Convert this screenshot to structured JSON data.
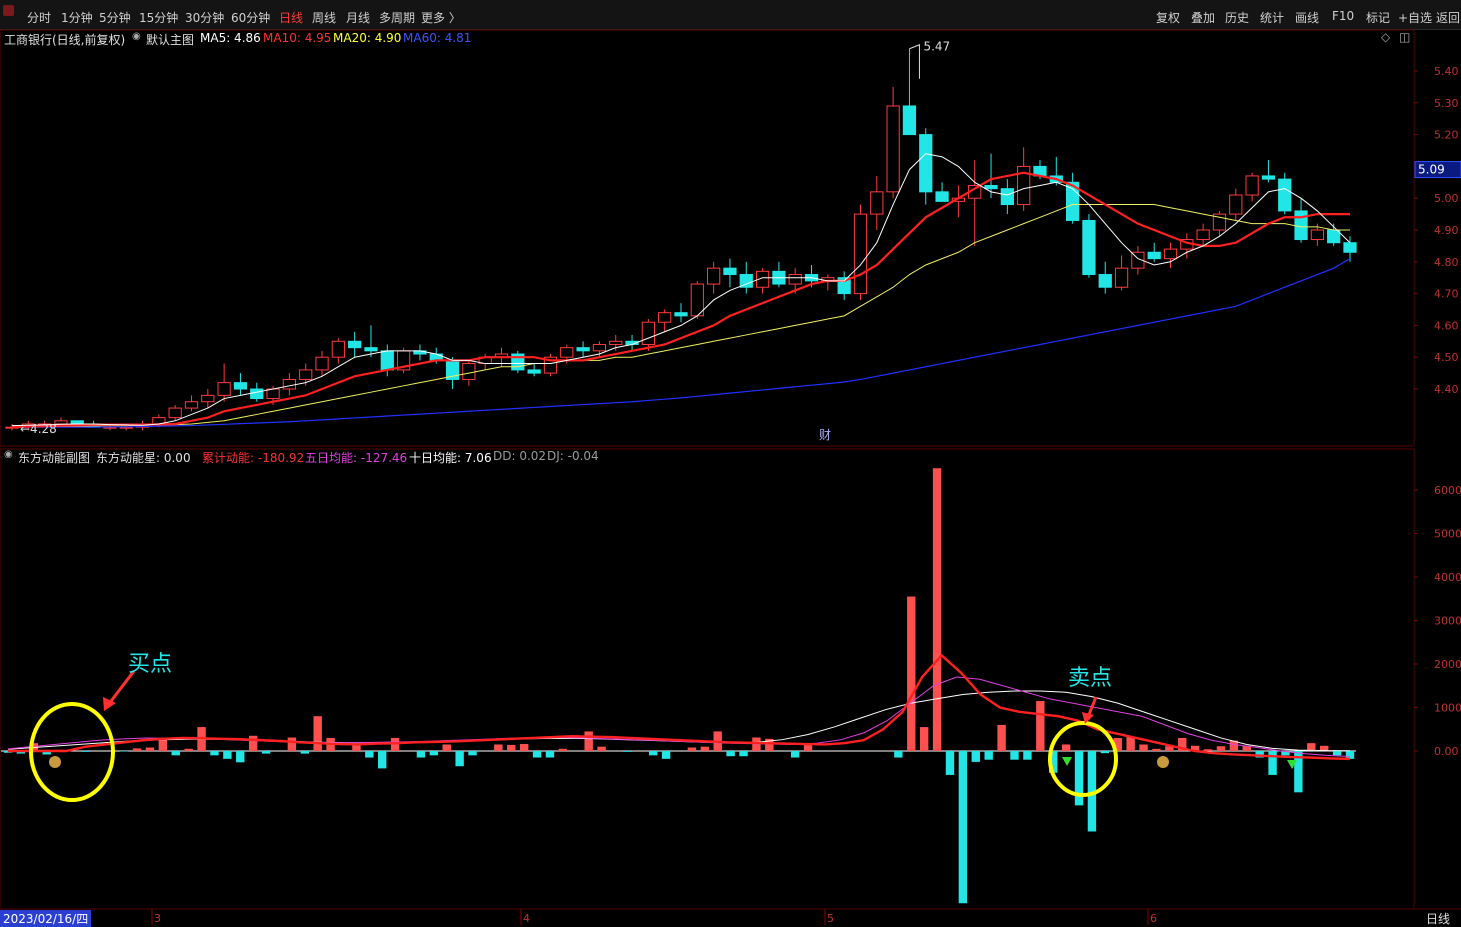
{
  "toolbar": {
    "left_items": [
      "分时",
      "1分钟",
      "5分钟",
      "15分钟",
      "30分钟",
      "60分钟",
      "日线",
      "周线",
      "月线",
      "多周期",
      "更多 〉"
    ],
    "active": "日线",
    "right_items": [
      "复权",
      "叠加",
      "历史",
      "统计",
      "画线",
      "F10",
      "标记",
      "+自选",
      "返回"
    ]
  },
  "main_chart": {
    "stock": "工商银行(日线,前复权)",
    "template": "默认主图",
    "ma_legend": [
      {
        "label": "MA5: 4.86",
        "color": "#ffffff"
      },
      {
        "label": "MA10: 4.95",
        "color": "#ff3030"
      },
      {
        "label": "MA20: 4.90",
        "color": "#ffff40"
      },
      {
        "label": "MA60: 4.81",
        "color": "#3a55ff"
      }
    ],
    "max_label": "5.47",
    "min_label": "4.28",
    "current_price": "5.09",
    "finance_marker": "财",
    "colors": {
      "up": "#ff3b3b",
      "down": "#22e6e6",
      "ma5": "#ffffff",
      "ma10": "#ff2020",
      "ma20": "#f0f060",
      "ma60": "#2030ff"
    }
  },
  "sub_chart": {
    "title": "东方动能副图",
    "star_label": "东方动能星: 0.00",
    "legend": [
      {
        "label": "累计动能: -180.92",
        "color": "#ff3030"
      },
      {
        "label": "五日均能: -127.46",
        "color": "#e040e0"
      },
      {
        "label": "十日均能: 7.06",
        "color": "#ffffff"
      },
      {
        "label": "DD: 0.02",
        "color": "#9a9a9a"
      },
      {
        "label": "DJ: -0.04",
        "color": "#9a9a9a"
      }
    ],
    "buy_annotation": "买点",
    "sell_annotation": "卖点"
  },
  "time_axis": {
    "date_label": "2023/02/16/四",
    "months": [
      "3",
      "4",
      "5",
      "6"
    ],
    "period_label": "日线"
  },
  "chart_data": [
    {
      "type": "candlestick",
      "title": "工商银行(日线,前复权)",
      "price_axis_ticks": [
        4.4,
        4.5,
        4.6,
        4.7,
        4.8,
        4.9,
        5.0,
        5.1,
        5.2,
        5.3,
        5.4
      ],
      "ylim": [
        4.28,
        5.47
      ],
      "candles": [
        [
          4.28,
          4.29,
          4.27,
          4.28
        ],
        [
          4.28,
          4.3,
          4.27,
          4.29
        ],
        [
          4.29,
          4.3,
          4.28,
          4.29
        ],
        [
          4.29,
          4.31,
          4.28,
          4.3
        ],
        [
          4.3,
          4.3,
          4.28,
          4.29
        ],
        [
          4.29,
          4.3,
          4.28,
          4.28
        ],
        [
          4.28,
          4.29,
          4.27,
          4.28
        ],
        [
          4.28,
          4.29,
          4.27,
          4.28
        ],
        [
          4.28,
          4.3,
          4.27,
          4.29
        ],
        [
          4.29,
          4.32,
          4.28,
          4.31
        ],
        [
          4.31,
          4.35,
          4.3,
          4.34
        ],
        [
          4.34,
          4.38,
          4.33,
          4.36
        ],
        [
          4.36,
          4.4,
          4.34,
          4.38
        ],
        [
          4.38,
          4.48,
          4.36,
          4.42
        ],
        [
          4.42,
          4.45,
          4.38,
          4.4
        ],
        [
          4.4,
          4.42,
          4.36,
          4.37
        ],
        [
          4.37,
          4.41,
          4.35,
          4.4
        ],
        [
          4.4,
          4.45,
          4.38,
          4.43
        ],
        [
          4.43,
          4.48,
          4.41,
          4.46
        ],
        [
          4.46,
          4.52,
          4.44,
          4.5
        ],
        [
          4.5,
          4.56,
          4.48,
          4.55
        ],
        [
          4.55,
          4.58,
          4.5,
          4.53
        ],
        [
          4.53,
          4.6,
          4.5,
          4.52
        ],
        [
          4.52,
          4.54,
          4.44,
          4.46
        ],
        [
          4.46,
          4.53,
          4.45,
          4.52
        ],
        [
          4.52,
          4.54,
          4.49,
          4.51
        ],
        [
          4.51,
          4.53,
          4.48,
          4.49
        ],
        [
          4.49,
          4.5,
          4.4,
          4.43
        ],
        [
          4.43,
          4.49,
          4.41,
          4.48
        ],
        [
          4.48,
          4.51,
          4.46,
          4.5
        ],
        [
          4.5,
          4.53,
          4.47,
          4.51
        ],
        [
          4.51,
          4.52,
          4.45,
          4.46
        ],
        [
          4.46,
          4.48,
          4.44,
          4.45
        ],
        [
          4.45,
          4.51,
          4.44,
          4.5
        ],
        [
          4.5,
          4.54,
          4.48,
          4.53
        ],
        [
          4.53,
          4.55,
          4.5,
          4.52
        ],
        [
          4.52,
          4.55,
          4.5,
          4.54
        ],
        [
          4.54,
          4.57,
          4.52,
          4.55
        ],
        [
          4.55,
          4.57,
          4.52,
          4.54
        ],
        [
          4.54,
          4.62,
          4.52,
          4.61
        ],
        [
          4.61,
          4.65,
          4.58,
          4.64
        ],
        [
          4.64,
          4.67,
          4.61,
          4.63
        ],
        [
          4.63,
          4.74,
          4.62,
          4.73
        ],
        [
          4.73,
          4.8,
          4.7,
          4.78
        ],
        [
          4.78,
          4.81,
          4.72,
          4.76
        ],
        [
          4.76,
          4.8,
          4.7,
          4.72
        ],
        [
          4.72,
          4.78,
          4.7,
          4.77
        ],
        [
          4.77,
          4.8,
          4.72,
          4.73
        ],
        [
          4.73,
          4.78,
          4.7,
          4.76
        ],
        [
          4.76,
          4.79,
          4.72,
          4.74
        ],
        [
          4.74,
          4.76,
          4.71,
          4.75
        ],
        [
          4.75,
          4.77,
          4.68,
          4.7
        ],
        [
          4.7,
          4.98,
          4.68,
          4.95
        ],
        [
          4.95,
          5.07,
          4.9,
          5.02
        ],
        [
          5.02,
          5.35,
          5.0,
          5.29
        ],
        [
          5.29,
          5.47,
          5.2,
          5.2
        ],
        [
          5.2,
          5.22,
          4.98,
          5.02
        ],
        [
          5.02,
          5.05,
          4.99,
          4.99
        ],
        [
          4.99,
          5.04,
          4.94,
          5.0
        ],
        [
          5.0,
          5.12,
          4.85,
          5.04
        ],
        [
          5.04,
          5.14,
          5.0,
          5.03
        ],
        [
          5.03,
          5.06,
          4.95,
          4.98
        ],
        [
          4.98,
          5.16,
          4.96,
          5.1
        ],
        [
          5.1,
          5.12,
          5.06,
          5.07
        ],
        [
          5.07,
          5.13,
          5.04,
          5.05
        ],
        [
          5.05,
          5.08,
          4.92,
          4.93
        ],
        [
          4.93,
          4.95,
          4.75,
          4.76
        ],
        [
          4.76,
          4.8,
          4.7,
          4.72
        ],
        [
          4.72,
          4.82,
          4.71,
          4.78
        ],
        [
          4.78,
          4.85,
          4.76,
          4.83
        ],
        [
          4.83,
          4.86,
          4.8,
          4.81
        ],
        [
          4.81,
          4.86,
          4.78,
          4.84
        ],
        [
          4.84,
          4.89,
          4.81,
          4.87
        ],
        [
          4.87,
          4.92,
          4.85,
          4.9
        ],
        [
          4.9,
          4.96,
          4.88,
          4.95
        ],
        [
          4.95,
          5.03,
          4.93,
          5.01
        ],
        [
          5.01,
          5.08,
          4.99,
          5.07
        ],
        [
          5.07,
          5.12,
          5.05,
          5.06
        ],
        [
          5.06,
          5.08,
          4.95,
          4.96
        ],
        [
          4.96,
          5.0,
          4.86,
          4.87
        ],
        [
          4.87,
          4.92,
          4.85,
          4.9
        ],
        [
          4.9,
          4.92,
          4.85,
          4.86
        ],
        [
          4.86,
          4.88,
          4.8,
          4.83
        ]
      ],
      "ma5": [
        4.285,
        4.286,
        4.287,
        4.289,
        4.29,
        4.29,
        4.288,
        4.287,
        4.286,
        4.29,
        4.3,
        4.32,
        4.34,
        4.37,
        4.38,
        4.39,
        4.4,
        4.41,
        4.42,
        4.44,
        4.47,
        4.5,
        4.51,
        4.52,
        4.52,
        4.52,
        4.51,
        4.49,
        4.49,
        4.48,
        4.48,
        4.48,
        4.48,
        4.48,
        4.49,
        4.5,
        4.51,
        4.53,
        4.54,
        4.56,
        4.58,
        4.6,
        4.63,
        4.68,
        4.71,
        4.73,
        4.75,
        4.75,
        4.75,
        4.75,
        4.74,
        4.74,
        4.79,
        4.86,
        4.98,
        5.09,
        5.14,
        5.13,
        5.1,
        5.05,
        5.02,
        5.01,
        5.03,
        5.04,
        5.05,
        5.03,
        4.98,
        4.92,
        4.86,
        4.81,
        4.79,
        4.8,
        4.83,
        4.85,
        4.88,
        4.92,
        4.97,
        5.02,
        5.03,
        5.0,
        4.96,
        4.91,
        4.86
      ],
      "ma10": [
        4.28,
        4.282,
        4.283,
        4.285,
        4.286,
        4.288,
        4.288,
        4.288,
        4.288,
        4.289,
        4.29,
        4.3,
        4.31,
        4.33,
        4.34,
        4.35,
        4.36,
        4.37,
        4.38,
        4.4,
        4.42,
        4.44,
        4.45,
        4.46,
        4.47,
        4.48,
        4.49,
        4.49,
        4.49,
        4.5,
        4.5,
        4.5,
        4.5,
        4.49,
        4.49,
        4.49,
        4.5,
        4.51,
        4.52,
        4.53,
        4.54,
        4.56,
        4.58,
        4.6,
        4.63,
        4.65,
        4.67,
        4.69,
        4.71,
        4.73,
        4.74,
        4.74,
        4.76,
        4.79,
        4.84,
        4.89,
        4.94,
        4.97,
        5.0,
        5.03,
        5.06,
        5.07,
        5.08,
        5.07,
        5.06,
        5.04,
        5.01,
        4.98,
        4.95,
        4.92,
        4.9,
        4.88,
        4.86,
        4.85,
        4.85,
        4.86,
        4.89,
        4.92,
        4.94,
        4.94,
        4.95,
        4.95,
        4.95
      ],
      "ma20": [
        4.28,
        4.281,
        4.282,
        4.283,
        4.283,
        4.284,
        4.285,
        4.285,
        4.286,
        4.287,
        4.288,
        4.29,
        4.295,
        4.3,
        4.31,
        4.32,
        4.33,
        4.34,
        4.35,
        4.36,
        4.37,
        4.38,
        4.39,
        4.4,
        4.41,
        4.42,
        4.43,
        4.44,
        4.45,
        4.46,
        4.47,
        4.47,
        4.48,
        4.48,
        4.49,
        4.49,
        4.49,
        4.5,
        4.5,
        4.51,
        4.52,
        4.53,
        4.54,
        4.55,
        4.56,
        4.57,
        4.58,
        4.59,
        4.6,
        4.61,
        4.62,
        4.63,
        4.66,
        4.69,
        4.72,
        4.76,
        4.79,
        4.81,
        4.83,
        4.86,
        4.88,
        4.9,
        4.92,
        4.94,
        4.96,
        4.98,
        4.98,
        4.98,
        4.98,
        4.98,
        4.98,
        4.97,
        4.96,
        4.95,
        4.94,
        4.93,
        4.92,
        4.92,
        4.92,
        4.91,
        4.91,
        4.9,
        4.9
      ],
      "ma60": [
        4.28,
        4.28,
        4.28,
        4.28,
        4.28,
        4.28,
        4.281,
        4.281,
        4.282,
        4.283,
        4.284,
        4.285,
        4.287,
        4.289,
        4.291,
        4.293,
        4.295,
        4.297,
        4.3,
        4.303,
        4.306,
        4.309,
        4.312,
        4.315,
        4.318,
        4.321,
        4.324,
        4.327,
        4.33,
        4.333,
        4.336,
        4.339,
        4.342,
        4.345,
        4.348,
        4.351,
        4.354,
        4.357,
        4.36,
        4.364,
        4.368,
        4.372,
        4.377,
        4.382,
        4.387,
        4.392,
        4.397,
        4.402,
        4.407,
        4.412,
        4.417,
        4.422,
        4.43,
        4.44,
        4.45,
        4.46,
        4.47,
        4.48,
        4.49,
        4.5,
        4.51,
        4.52,
        4.53,
        4.54,
        4.55,
        4.56,
        4.57,
        4.58,
        4.59,
        4.6,
        4.61,
        4.62,
        4.63,
        4.64,
        4.65,
        4.66,
        4.68,
        4.7,
        4.72,
        4.74,
        4.76,
        4.78,
        4.81
      ]
    },
    {
      "type": "bar",
      "title": "东方动能副图",
      "y_axis_ticks": [
        0,
        1000,
        2000,
        3000,
        4000,
        5000,
        6000
      ],
      "ylim": [
        -3500,
        6800
      ],
      "values": [
        -40,
        -60,
        180,
        -80,
        30,
        0,
        -20,
        0,
        0,
        -10,
        60,
        80,
        300,
        -100,
        50,
        550,
        -100,
        -180,
        -260,
        350,
        -60,
        0,
        310,
        -60,
        800,
        300,
        0,
        150,
        -150,
        -400,
        300,
        0,
        -150,
        -100,
        150,
        -350,
        -100,
        0,
        150,
        140,
        160,
        -150,
        -150,
        50,
        0,
        450,
        100,
        0,
        -20,
        0,
        -100,
        -180,
        0,
        80,
        100,
        450,
        -120,
        -120,
        310,
        280,
        0,
        -150,
        150,
        0,
        0,
        0,
        0,
        0,
        0,
        -150,
        3550,
        550,
        6500,
        -550,
        -3500,
        -250,
        -200,
        600,
        -200,
        -200,
        1150,
        -500,
        150,
        -1250,
        -1850,
        -50,
        300,
        320,
        150,
        50,
        110,
        300,
        120,
        40,
        110,
        240,
        120,
        -150,
        -550,
        -100,
        -950,
        180,
        120,
        -100,
        -180
      ],
      "cumulative_line": [
        0,
        0,
        0,
        0,
        100,
        150,
        200,
        250,
        280,
        300,
        290,
        280,
        270,
        250,
        230,
        200,
        180,
        160,
        150,
        170,
        180,
        200,
        210,
        220,
        240,
        260,
        280,
        300,
        320,
        340,
        330,
        320,
        300,
        280,
        260,
        240,
        220,
        200,
        190,
        180,
        170,
        160,
        150,
        180,
        250,
        500,
        900,
        1700,
        2200,
        1800,
        1300,
        1000,
        900,
        850,
        800,
        700,
        500,
        400,
        300,
        200,
        100,
        0,
        -50,
        -80,
        -100,
        -120,
        -140,
        -150,
        -170,
        -181
      ],
      "five_day_line": [
        50,
        100,
        150,
        200,
        250,
        280,
        300,
        290,
        280,
        270,
        250,
        230,
        210,
        200,
        190,
        190,
        200,
        210,
        220,
        240,
        260,
        280,
        300,
        310,
        310,
        300,
        280,
        260,
        240,
        220,
        200,
        180,
        170,
        160,
        150,
        180,
        260,
        420,
        700,
        1100,
        1500,
        1700,
        1650,
        1500,
        1350,
        1200,
        1100,
        1000,
        900,
        800,
        600,
        400,
        250,
        150,
        80,
        0,
        -60,
        -100,
        -127
      ],
      "ten_day_line": [
        40,
        80,
        120,
        160,
        200,
        240,
        260,
        270,
        270,
        260,
        240,
        220,
        200,
        190,
        190,
        200,
        210,
        230,
        250,
        270,
        280,
        290,
        290,
        280,
        260,
        240,
        220,
        200,
        190,
        200,
        260,
        380,
        550,
        750,
        950,
        1100,
        1200,
        1300,
        1350,
        1380,
        1380,
        1350,
        1250,
        1100,
        900,
        700,
        500,
        300,
        150,
        60,
        20,
        10,
        7
      ]
    }
  ]
}
